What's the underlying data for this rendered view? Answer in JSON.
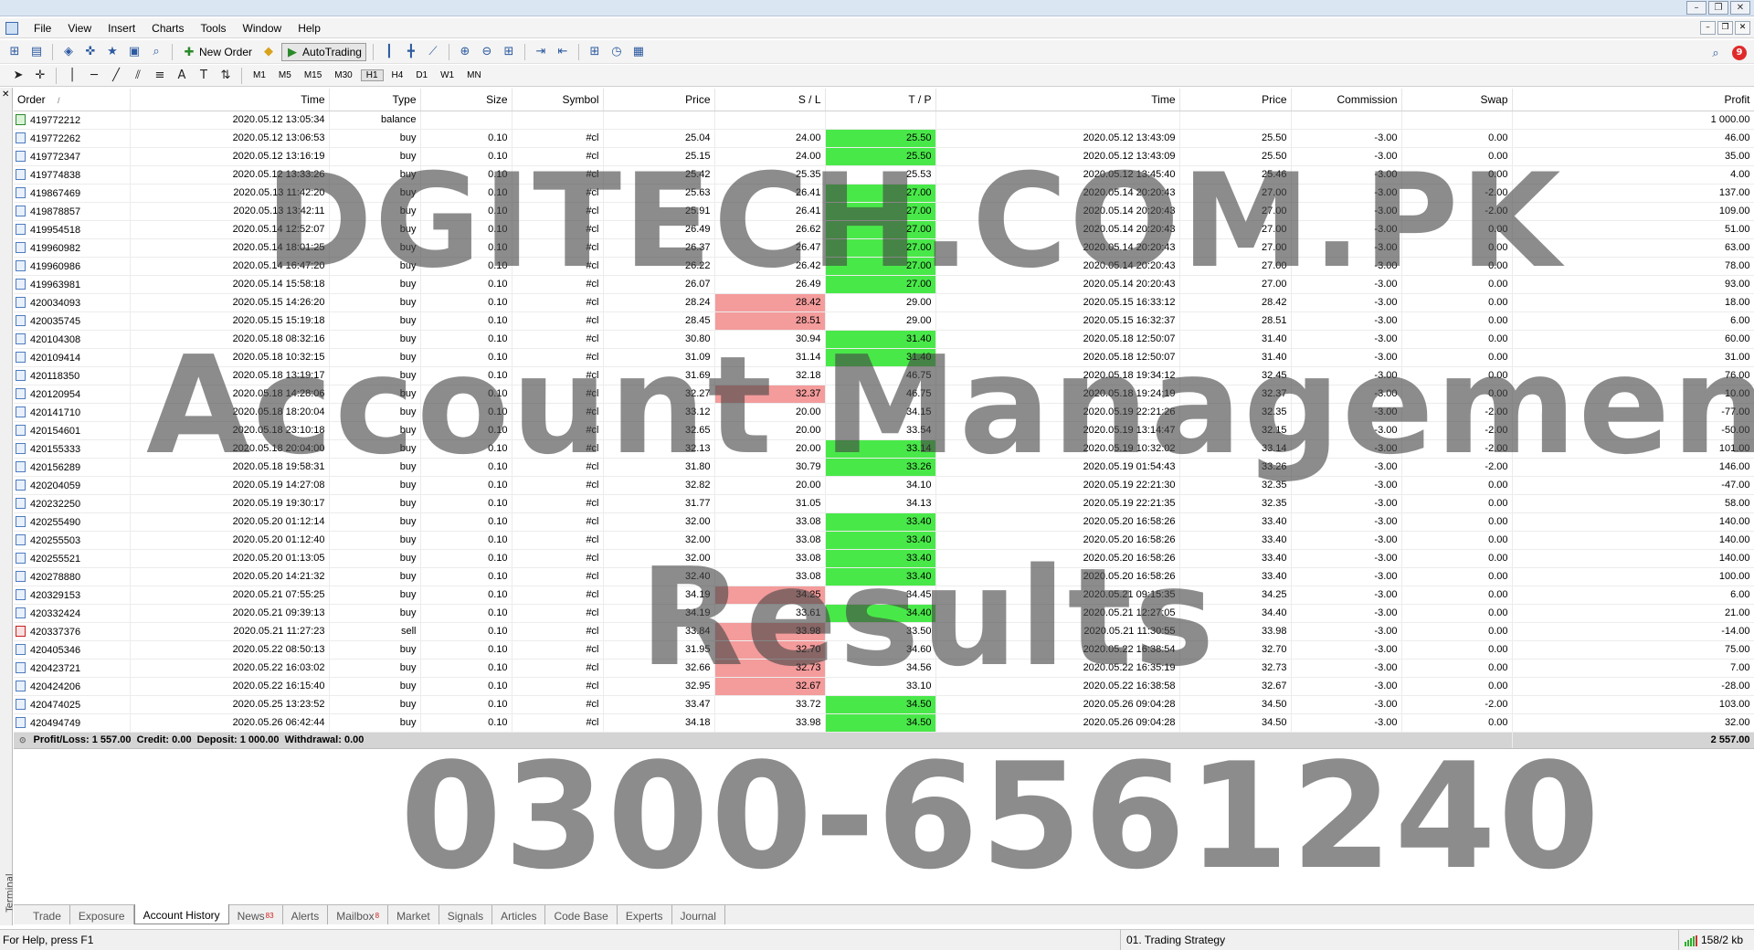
{
  "menubar": {
    "items": [
      "File",
      "View",
      "Insert",
      "Charts",
      "Tools",
      "Window",
      "Help"
    ]
  },
  "toolbar": {
    "new_order_label": "New Order",
    "autotrading_label": "AutoTrading",
    "timeframes": [
      "M1",
      "M5",
      "M15",
      "M30",
      "H1",
      "H4",
      "D1",
      "W1",
      "MN"
    ],
    "active_timeframe": "H1",
    "notifications_count": "9"
  },
  "table": {
    "headers": {
      "order": "Order",
      "time": "Time",
      "type": "Type",
      "size": "Size",
      "symbol": "Symbol",
      "price": "Price",
      "sl": "S / L",
      "tp": "T / P",
      "close_time": "Time",
      "close_price": "Price",
      "commission": "Commission",
      "swap": "Swap",
      "profit": "Profit"
    },
    "rows": [
      {
        "order": "419772212",
        "time": "2020.05.12 13:05:34",
        "type": "balance",
        "size": "",
        "symbol": "",
        "price": "",
        "sl": "",
        "tp": "",
        "ctime": "",
        "cprice": "",
        "comm": "",
        "swap": "",
        "profit": "1 000.00",
        "sl_hl": "",
        "tp_hl": ""
      },
      {
        "order": "419772262",
        "time": "2020.05.12 13:06:53",
        "type": "buy",
        "size": "0.10",
        "symbol": "#cl",
        "price": "25.04",
        "sl": "24.00",
        "tp": "25.50",
        "ctime": "2020.05.12 13:43:09",
        "cprice": "25.50",
        "comm": "-3.00",
        "swap": "0.00",
        "profit": "46.00",
        "sl_hl": "",
        "tp_hl": "green"
      },
      {
        "order": "419772347",
        "time": "2020.05.12 13:16:19",
        "type": "buy",
        "size": "0.10",
        "symbol": "#cl",
        "price": "25.15",
        "sl": "24.00",
        "tp": "25.50",
        "ctime": "2020.05.12 13:43:09",
        "cprice": "25.50",
        "comm": "-3.00",
        "swap": "0.00",
        "profit": "35.00",
        "sl_hl": "",
        "tp_hl": "green"
      },
      {
        "order": "419774838",
        "time": "2020.05.12 13:33:26",
        "type": "buy",
        "size": "0.10",
        "symbol": "#cl",
        "price": "25.42",
        "sl": "25.35",
        "tp": "25.53",
        "ctime": "2020.05.12 13:45:40",
        "cprice": "25.46",
        "comm": "-3.00",
        "swap": "0.00",
        "profit": "4.00",
        "sl_hl": "",
        "tp_hl": ""
      },
      {
        "order": "419867469",
        "time": "2020.05.13 11:42:20",
        "type": "buy",
        "size": "0.10",
        "symbol": "#cl",
        "price": "25.63",
        "sl": "26.41",
        "tp": "27.00",
        "ctime": "2020.05.14 20:20:43",
        "cprice": "27.00",
        "comm": "-3.00",
        "swap": "-2.00",
        "profit": "137.00",
        "sl_hl": "",
        "tp_hl": "green"
      },
      {
        "order": "419878857",
        "time": "2020.05.13 13:42:11",
        "type": "buy",
        "size": "0.10",
        "symbol": "#cl",
        "price": "25.91",
        "sl": "26.41",
        "tp": "27.00",
        "ctime": "2020.05.14 20:20:43",
        "cprice": "27.00",
        "comm": "-3.00",
        "swap": "-2.00",
        "profit": "109.00",
        "sl_hl": "",
        "tp_hl": "green"
      },
      {
        "order": "419954518",
        "time": "2020.05.14 12:52:07",
        "type": "buy",
        "size": "0.10",
        "symbol": "#cl",
        "price": "26.49",
        "sl": "26.62",
        "tp": "27.00",
        "ctime": "2020.05.14 20:20:43",
        "cprice": "27.00",
        "comm": "-3.00",
        "swap": "0.00",
        "profit": "51.00",
        "sl_hl": "",
        "tp_hl": "green"
      },
      {
        "order": "419960982",
        "time": "2020.05.14 18:01:25",
        "type": "buy",
        "size": "0.10",
        "symbol": "#cl",
        "price": "26.37",
        "sl": "26.47",
        "tp": "27.00",
        "ctime": "2020.05.14 20:20:43",
        "cprice": "27.00",
        "comm": "-3.00",
        "swap": "0.00",
        "profit": "63.00",
        "sl_hl": "",
        "tp_hl": "green"
      },
      {
        "order": "419960986",
        "time": "2020.05.14 16:47:20",
        "type": "buy",
        "size": "0.10",
        "symbol": "#cl",
        "price": "26.22",
        "sl": "26.42",
        "tp": "27.00",
        "ctime": "2020.05.14 20:20:43",
        "cprice": "27.00",
        "comm": "-3.00",
        "swap": "0.00",
        "profit": "78.00",
        "sl_hl": "",
        "tp_hl": "green"
      },
      {
        "order": "419963981",
        "time": "2020.05.14 15:58:18",
        "type": "buy",
        "size": "0.10",
        "symbol": "#cl",
        "price": "26.07",
        "sl": "26.49",
        "tp": "27.00",
        "ctime": "2020.05.14 20:20:43",
        "cprice": "27.00",
        "comm": "-3.00",
        "swap": "0.00",
        "profit": "93.00",
        "sl_hl": "",
        "tp_hl": "green"
      },
      {
        "order": "420034093",
        "time": "2020.05.15 14:26:20",
        "type": "buy",
        "size": "0.10",
        "symbol": "#cl",
        "price": "28.24",
        "sl": "28.42",
        "tp": "29.00",
        "ctime": "2020.05.15 16:33:12",
        "cprice": "28.42",
        "comm": "-3.00",
        "swap": "0.00",
        "profit": "18.00",
        "sl_hl": "red",
        "tp_hl": ""
      },
      {
        "order": "420035745",
        "time": "2020.05.15 15:19:18",
        "type": "buy",
        "size": "0.10",
        "symbol": "#cl",
        "price": "28.45",
        "sl": "28.51",
        "tp": "29.00",
        "ctime": "2020.05.15 16:32:37",
        "cprice": "28.51",
        "comm": "-3.00",
        "swap": "0.00",
        "profit": "6.00",
        "sl_hl": "red",
        "tp_hl": ""
      },
      {
        "order": "420104308",
        "time": "2020.05.18 08:32:16",
        "type": "buy",
        "size": "0.10",
        "symbol": "#cl",
        "price": "30.80",
        "sl": "30.94",
        "tp": "31.40",
        "ctime": "2020.05.18 12:50:07",
        "cprice": "31.40",
        "comm": "-3.00",
        "swap": "0.00",
        "profit": "60.00",
        "sl_hl": "",
        "tp_hl": "green"
      },
      {
        "order": "420109414",
        "time": "2020.05.18 10:32:15",
        "type": "buy",
        "size": "0.10",
        "symbol": "#cl",
        "price": "31.09",
        "sl": "31.14",
        "tp": "31.40",
        "ctime": "2020.05.18 12:50:07",
        "cprice": "31.40",
        "comm": "-3.00",
        "swap": "0.00",
        "profit": "31.00",
        "sl_hl": "",
        "tp_hl": "green"
      },
      {
        "order": "420118350",
        "time": "2020.05.18 13:19:17",
        "type": "buy",
        "size": "0.10",
        "symbol": "#cl",
        "price": "31.69",
        "sl": "32.18",
        "tp": "46.75",
        "ctime": "2020.05.18 19:34:12",
        "cprice": "32.45",
        "comm": "-3.00",
        "swap": "0.00",
        "profit": "76.00",
        "sl_hl": "",
        "tp_hl": ""
      },
      {
        "order": "420120954",
        "time": "2020.05.18 14:28:06",
        "type": "buy",
        "size": "0.10",
        "symbol": "#cl",
        "price": "32.27",
        "sl": "32.37",
        "tp": "46.75",
        "ctime": "2020.05.18 19:24:19",
        "cprice": "32.37",
        "comm": "-3.00",
        "swap": "0.00",
        "profit": "10.00",
        "sl_hl": "red",
        "tp_hl": ""
      },
      {
        "order": "420141710",
        "time": "2020.05.18 18:20:04",
        "type": "buy",
        "size": "0.10",
        "symbol": "#cl",
        "price": "33.12",
        "sl": "20.00",
        "tp": "34.15",
        "ctime": "2020.05.19 22:21:26",
        "cprice": "32.35",
        "comm": "-3.00",
        "swap": "-2.00",
        "profit": "-77.00",
        "sl_hl": "",
        "tp_hl": ""
      },
      {
        "order": "420154601",
        "time": "2020.05.18 23:10:18",
        "type": "buy",
        "size": "0.10",
        "symbol": "#cl",
        "price": "32.65",
        "sl": "20.00",
        "tp": "33.54",
        "ctime": "2020.05.19 13:14:47",
        "cprice": "32.15",
        "comm": "-3.00",
        "swap": "-2.00",
        "profit": "-50.00",
        "sl_hl": "",
        "tp_hl": ""
      },
      {
        "order": "420155333",
        "time": "2020.05.18 20:04:00",
        "type": "buy",
        "size": "0.10",
        "symbol": "#cl",
        "price": "32.13",
        "sl": "20.00",
        "tp": "33.14",
        "ctime": "2020.05.19 10:32:02",
        "cprice": "33.14",
        "comm": "-3.00",
        "swap": "-2.00",
        "profit": "101.00",
        "sl_hl": "",
        "tp_hl": "green"
      },
      {
        "order": "420156289",
        "time": "2020.05.18 19:58:31",
        "type": "buy",
        "size": "0.10",
        "symbol": "#cl",
        "price": "31.80",
        "sl": "30.79",
        "tp": "33.26",
        "ctime": "2020.05.19 01:54:43",
        "cprice": "33.26",
        "comm": "-3.00",
        "swap": "-2.00",
        "profit": "146.00",
        "sl_hl": "",
        "tp_hl": "green"
      },
      {
        "order": "420204059",
        "time": "2020.05.19 14:27:08",
        "type": "buy",
        "size": "0.10",
        "symbol": "#cl",
        "price": "32.82",
        "sl": "20.00",
        "tp": "34.10",
        "ctime": "2020.05.19 22:21:30",
        "cprice": "32.35",
        "comm": "-3.00",
        "swap": "0.00",
        "profit": "-47.00",
        "sl_hl": "",
        "tp_hl": ""
      },
      {
        "order": "420232250",
        "time": "2020.05.19 19:30:17",
        "type": "buy",
        "size": "0.10",
        "symbol": "#cl",
        "price": "31.77",
        "sl": "31.05",
        "tp": "34.13",
        "ctime": "2020.05.19 22:21:35",
        "cprice": "32.35",
        "comm": "-3.00",
        "swap": "0.00",
        "profit": "58.00",
        "sl_hl": "",
        "tp_hl": ""
      },
      {
        "order": "420255490",
        "time": "2020.05.20 01:12:14",
        "type": "buy",
        "size": "0.10",
        "symbol": "#cl",
        "price": "32.00",
        "sl": "33.08",
        "tp": "33.40",
        "ctime": "2020.05.20 16:58:26",
        "cprice": "33.40",
        "comm": "-3.00",
        "swap": "0.00",
        "profit": "140.00",
        "sl_hl": "",
        "tp_hl": "green"
      },
      {
        "order": "420255503",
        "time": "2020.05.20 01:12:40",
        "type": "buy",
        "size": "0.10",
        "symbol": "#cl",
        "price": "32.00",
        "sl": "33.08",
        "tp": "33.40",
        "ctime": "2020.05.20 16:58:26",
        "cprice": "33.40",
        "comm": "-3.00",
        "swap": "0.00",
        "profit": "140.00",
        "sl_hl": "",
        "tp_hl": "green"
      },
      {
        "order": "420255521",
        "time": "2020.05.20 01:13:05",
        "type": "buy",
        "size": "0.10",
        "symbol": "#cl",
        "price": "32.00",
        "sl": "33.08",
        "tp": "33.40",
        "ctime": "2020.05.20 16:58:26",
        "cprice": "33.40",
        "comm": "-3.00",
        "swap": "0.00",
        "profit": "140.00",
        "sl_hl": "",
        "tp_hl": "green"
      },
      {
        "order": "420278880",
        "time": "2020.05.20 14:21:32",
        "type": "buy",
        "size": "0.10",
        "symbol": "#cl",
        "price": "32.40",
        "sl": "33.08",
        "tp": "33.40",
        "ctime": "2020.05.20 16:58:26",
        "cprice": "33.40",
        "comm": "-3.00",
        "swap": "0.00",
        "profit": "100.00",
        "sl_hl": "",
        "tp_hl": "green"
      },
      {
        "order": "420329153",
        "time": "2020.05.21 07:55:25",
        "type": "buy",
        "size": "0.10",
        "symbol": "#cl",
        "price": "34.19",
        "sl": "34.25",
        "tp": "34.45",
        "ctime": "2020.05.21 09:15:35",
        "cprice": "34.25",
        "comm": "-3.00",
        "swap": "0.00",
        "profit": "6.00",
        "sl_hl": "red",
        "tp_hl": ""
      },
      {
        "order": "420332424",
        "time": "2020.05.21 09:39:13",
        "type": "buy",
        "size": "0.10",
        "symbol": "#cl",
        "price": "34.19",
        "sl": "33.61",
        "tp": "34.40",
        "ctime": "2020.05.21 12:27:05",
        "cprice": "34.40",
        "comm": "-3.00",
        "swap": "0.00",
        "profit": "21.00",
        "sl_hl": "",
        "tp_hl": "green"
      },
      {
        "order": "420337376",
        "time": "2020.05.21 11:27:23",
        "type": "sell",
        "size": "0.10",
        "symbol": "#cl",
        "price": "33.84",
        "sl": "33.98",
        "tp": "33.50",
        "ctime": "2020.05.21 11:30:55",
        "cprice": "33.98",
        "comm": "-3.00",
        "swap": "0.00",
        "profit": "-14.00",
        "sl_hl": "red",
        "tp_hl": ""
      },
      {
        "order": "420405346",
        "time": "2020.05.22 08:50:13",
        "type": "buy",
        "size": "0.10",
        "symbol": "#cl",
        "price": "31.95",
        "sl": "32.70",
        "tp": "34.60",
        "ctime": "2020.05.22 16:38:54",
        "cprice": "32.70",
        "comm": "-3.00",
        "swap": "0.00",
        "profit": "75.00",
        "sl_hl": "red",
        "tp_hl": ""
      },
      {
        "order": "420423721",
        "time": "2020.05.22 16:03:02",
        "type": "buy",
        "size": "0.10",
        "symbol": "#cl",
        "price": "32.66",
        "sl": "32.73",
        "tp": "34.56",
        "ctime": "2020.05.22 16:35:19",
        "cprice": "32.73",
        "comm": "-3.00",
        "swap": "0.00",
        "profit": "7.00",
        "sl_hl": "red",
        "tp_hl": ""
      },
      {
        "order": "420424206",
        "time": "2020.05.22 16:15:40",
        "type": "buy",
        "size": "0.10",
        "symbol": "#cl",
        "price": "32.95",
        "sl": "32.67",
        "tp": "33.10",
        "ctime": "2020.05.22 16:38:58",
        "cprice": "32.67",
        "comm": "-3.00",
        "swap": "0.00",
        "profit": "-28.00",
        "sl_hl": "red",
        "tp_hl": ""
      },
      {
        "order": "420474025",
        "time": "2020.05.25 13:23:52",
        "type": "buy",
        "size": "0.10",
        "symbol": "#cl",
        "price": "33.47",
        "sl": "33.72",
        "tp": "34.50",
        "ctime": "2020.05.26 09:04:28",
        "cprice": "34.50",
        "comm": "-3.00",
        "swap": "-2.00",
        "profit": "103.00",
        "sl_hl": "",
        "tp_hl": "green"
      },
      {
        "order": "420494749",
        "time": "2020.05.26 06:42:44",
        "type": "buy",
        "size": "0.10",
        "symbol": "#cl",
        "price": "34.18",
        "sl": "33.98",
        "tp": "34.50",
        "ctime": "2020.05.26 09:04:28",
        "cprice": "34.50",
        "comm": "-3.00",
        "swap": "0.00",
        "profit": "32.00",
        "sl_hl": "",
        "tp_hl": "green"
      }
    ],
    "summary": {
      "text": "Profit/Loss: 1 557.00  Credit: 0.00  Deposit: 1 000.00  Withdrawal: 0.00",
      "total": "2 557.00"
    },
    "colors": {
      "tp_hit": "#49e849",
      "sl_hit": "#f49b9b",
      "summary_bg": "#d4d4d4"
    }
  },
  "watermark": {
    "line1": "DGITECH.COM.PK",
    "line2": "Account Management",
    "line3": "Results",
    "line4": "0300-6561240"
  },
  "tabs": [
    {
      "label": "Trade",
      "badge": ""
    },
    {
      "label": "Exposure",
      "badge": ""
    },
    {
      "label": "Account History",
      "badge": "",
      "active": true
    },
    {
      "label": "News",
      "badge": "83"
    },
    {
      "label": "Alerts",
      "badge": ""
    },
    {
      "label": "Mailbox",
      "badge": "8"
    },
    {
      "label": "Market",
      "badge": ""
    },
    {
      "label": "Signals",
      "badge": ""
    },
    {
      "label": "Articles",
      "badge": ""
    },
    {
      "label": "Code Base",
      "badge": ""
    },
    {
      "label": "Experts",
      "badge": ""
    },
    {
      "label": "Journal",
      "badge": ""
    }
  ],
  "terminal_label": "Terminal",
  "statusbar": {
    "help": "For Help, press F1",
    "profile": "01. Trading Strategy",
    "traffic": "158/2 kb"
  }
}
